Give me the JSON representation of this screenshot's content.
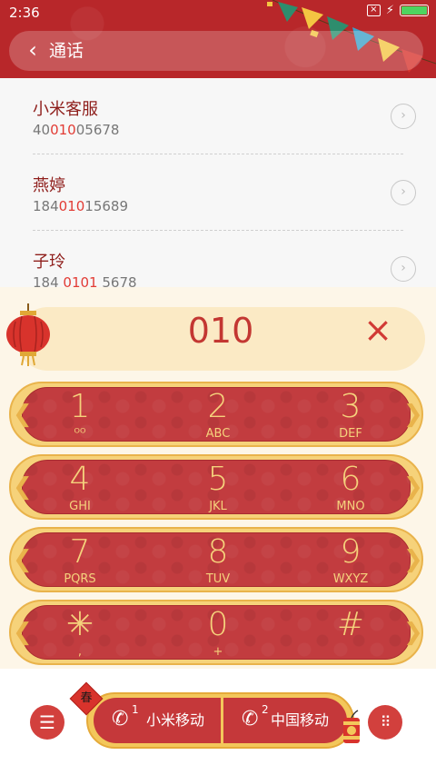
{
  "status": {
    "time": "2:36",
    "icons": [
      "sim-off-icon",
      "charging-icon",
      "battery-icon"
    ],
    "battery_color": "#4ed45f"
  },
  "header": {
    "title": "通话",
    "back_icon": "back-arrow-icon",
    "accent": "#b8272a"
  },
  "contacts": [
    {
      "name": "小米客服",
      "num_pre": "40",
      "num_hl": "010",
      "num_post": "05678"
    },
    {
      "name": "燕婷",
      "num_pre": "184",
      "num_hl": "010",
      "num_post": "15689"
    },
    {
      "name": "子玲",
      "num_pre": "184 ",
      "num_hl": "0101",
      "num_post": " 5678"
    }
  ],
  "dialer": {
    "input": "010",
    "clear_icon": "×",
    "keys": [
      {
        "num": "1",
        "letters": "voicemail-icon"
      },
      {
        "num": "2",
        "letters": "ABC"
      },
      {
        "num": "3",
        "letters": "DEF"
      },
      {
        "num": "4",
        "letters": "GHI"
      },
      {
        "num": "5",
        "letters": "JKL"
      },
      {
        "num": "6",
        "letters": "MNO"
      },
      {
        "num": "7",
        "letters": "PQRS"
      },
      {
        "num": "8",
        "letters": "TUV"
      },
      {
        "num": "9",
        "letters": "WXYZ"
      },
      {
        "num": "✳",
        "letters": ","
      },
      {
        "num": "0",
        "letters": "+"
      },
      {
        "num": "#",
        "letters": ""
      }
    ]
  },
  "callbar": {
    "sim1": {
      "index": "1",
      "label": "小米移动"
    },
    "sim2": {
      "index": "2",
      "label": "中国移动"
    },
    "badge": "春"
  }
}
